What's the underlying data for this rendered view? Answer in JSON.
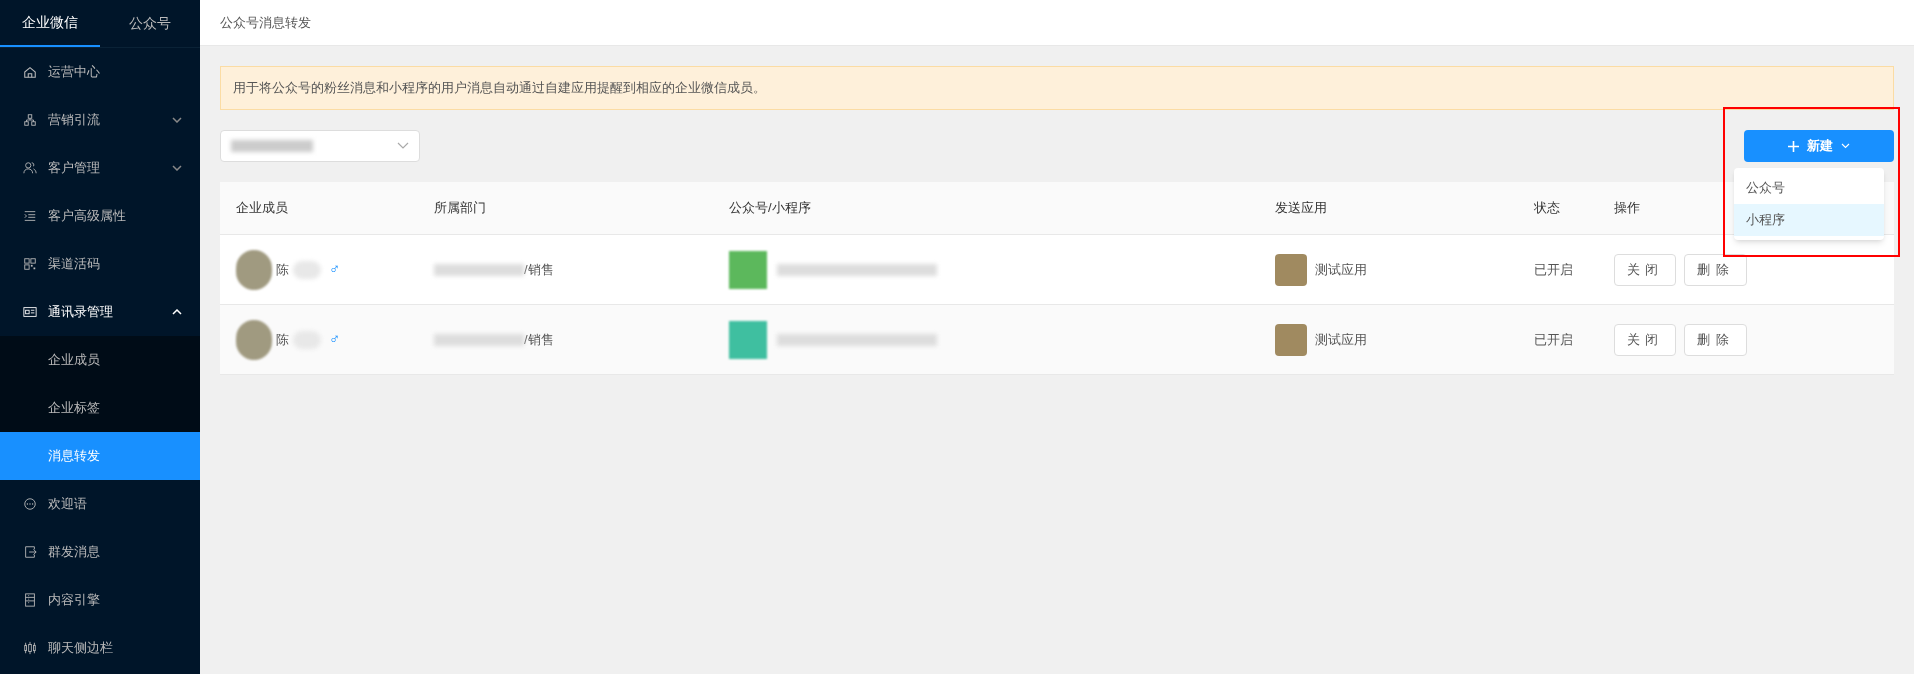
{
  "sidebar": {
    "tabs": [
      {
        "label": "企业微信",
        "selected": true
      },
      {
        "label": "公众号",
        "selected": false
      }
    ],
    "items": [
      {
        "label": "运营中心"
      },
      {
        "label": "营销引流",
        "expanded": false
      },
      {
        "label": "客户管理",
        "expanded": false
      },
      {
        "label": "客户高级属性"
      },
      {
        "label": "渠道活码"
      },
      {
        "label": "通讯录管理",
        "expanded": true,
        "children": [
          {
            "label": "企业成员",
            "selected": false
          },
          {
            "label": "企业标签",
            "selected": false
          },
          {
            "label": "消息转发",
            "selected": true
          }
        ]
      },
      {
        "label": "欢迎语"
      },
      {
        "label": "群发消息"
      },
      {
        "label": "内容引擎"
      },
      {
        "label": "聊天侧边栏"
      }
    ]
  },
  "page": {
    "title": "公众号消息转发",
    "notice": "用于将公众号的粉丝消息和小程序的用户消息自动通过自建应用提醒到相应的企业微信成员。"
  },
  "new_button": {
    "label": "新建",
    "menu": [
      {
        "label": "公众号",
        "selected": false
      },
      {
        "label": "小程序",
        "selected": true
      }
    ]
  },
  "table": {
    "columns": [
      "企业成员",
      "所属部门",
      "公众号/小程序",
      "发送应用",
      "状态",
      "操作"
    ],
    "rows": [
      {
        "member": "陈",
        "gender": "♂",
        "department": "/销售",
        "app": "测试应用",
        "status": "已开启",
        "actions": [
          "关闭",
          "删除"
        ],
        "color": "#5cb85c"
      },
      {
        "member": "陈",
        "gender": "♂",
        "department": "/销售",
        "app": "测试应用",
        "status": "已开启",
        "actions": [
          "关闭",
          "删除"
        ],
        "color": "#3fbfa0"
      }
    ]
  }
}
